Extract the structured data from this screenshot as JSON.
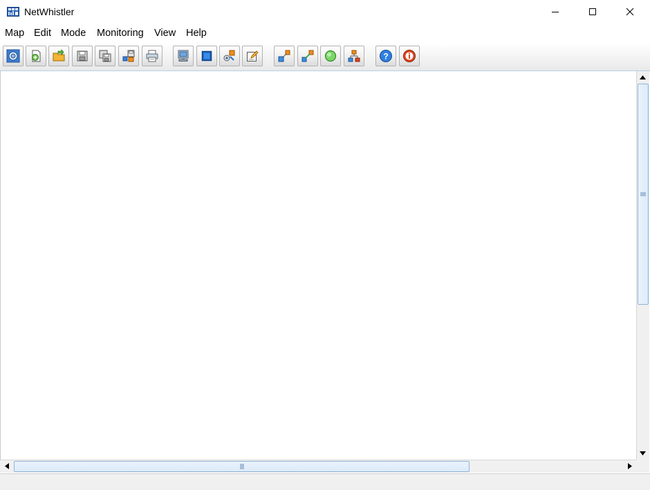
{
  "window": {
    "title": "NetWhistler",
    "icon": "network-map-icon",
    "controls": [
      "minimize-icon",
      "maximize-icon",
      "close-icon"
    ]
  },
  "menu": {
    "items": [
      "Map",
      "Edit",
      "Mode",
      "Monitoring",
      "View",
      "Help"
    ]
  },
  "toolbar": {
    "groups": [
      [
        "scan-network-icon",
        "new-map-icon",
        "open-map-icon",
        "save-map-icon",
        "save-as-icon",
        "export-icon",
        "print-icon"
      ],
      [
        "add-computer-icon",
        "add-node-icon",
        "add-device-icon",
        "edit-properties-icon"
      ],
      [
        "link-mode-icon",
        "connect-mode-icon",
        "monitor-start-icon",
        "network-layout-icon"
      ],
      [
        "help-icon",
        "about-icon"
      ]
    ]
  },
  "status": {
    "text": ""
  },
  "colors": {
    "accent_blue": "#1e6fd0",
    "toolbar_border": "#b2b2b2",
    "scroll_thumb": "#dceaf8",
    "alert_red": "#e0451f"
  }
}
